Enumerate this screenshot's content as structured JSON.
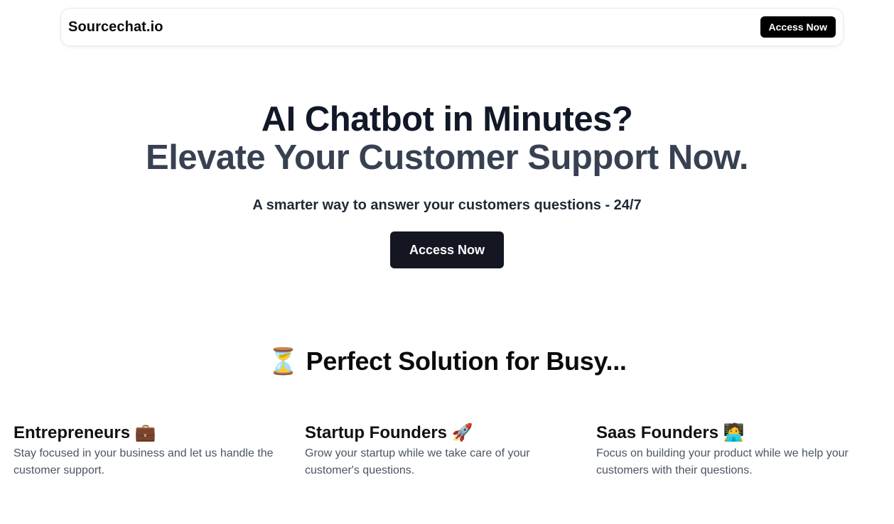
{
  "navbar": {
    "brand": "Sourcechat.io",
    "cta_label": "Access Now"
  },
  "hero": {
    "line1": "AI Chatbot in Minutes?",
    "line2": "Elevate Your Customer Support Now.",
    "subtitle": "A smarter way to answer your customers questions - 24/7",
    "cta_label": "Access Now"
  },
  "section": {
    "title": "⏳ Perfect Solution for Busy..."
  },
  "features": [
    {
      "title": "Entrepreneurs 💼",
      "description": "Stay focused in your business and let us handle the customer support."
    },
    {
      "title": "Startup Founders 🚀",
      "description": "Grow your startup while we take care of your customer's questions."
    },
    {
      "title": "Saas Founders 🧑‍💻",
      "description": "Focus on building your product while we help your customers with their questions."
    }
  ],
  "colors": {
    "primary_button": "#141722",
    "nav_button": "#000000",
    "heading_dark": "#111827",
    "heading_secondary": "#374151",
    "body_text": "#4b5563"
  }
}
